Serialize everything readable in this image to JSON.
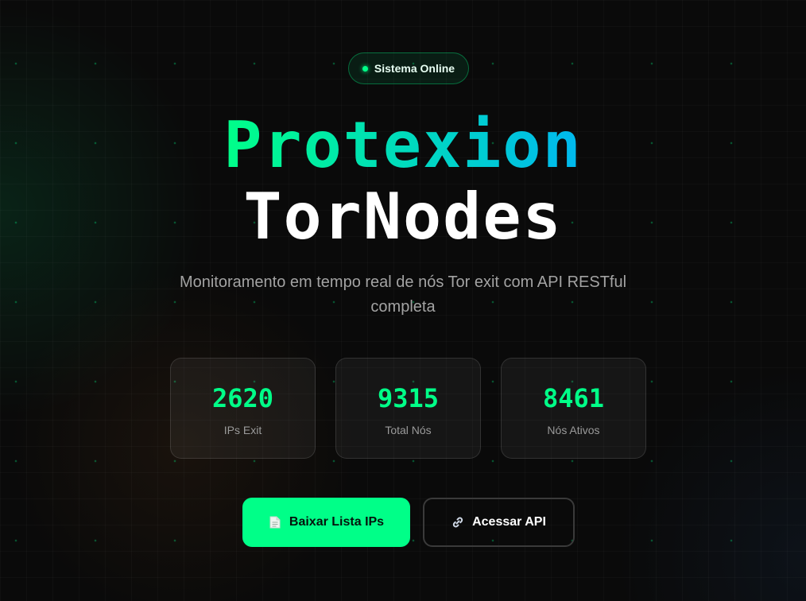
{
  "status_badge": {
    "label": "Sistema Online"
  },
  "hero": {
    "title_line1": "Protexion",
    "title_line2": "TorNodes",
    "subtitle_line1": "Monitoramento em tempo real de nós Tor exit com API RESTful",
    "subtitle_line2": "completa"
  },
  "stats": [
    {
      "value": "2620",
      "label": "IPs Exit"
    },
    {
      "value": "9315",
      "label": "Total Nós"
    },
    {
      "value": "8461",
      "label": "Nós Ativos"
    }
  ],
  "actions": {
    "download": {
      "label": "Baixar Lista IPs",
      "icon": "document-icon"
    },
    "api": {
      "label": "Acessar API",
      "icon": "link-icon"
    }
  },
  "colors": {
    "accent": "#00ff88",
    "accent_blue": "#00b8f0",
    "background": "#0a0a0a"
  }
}
